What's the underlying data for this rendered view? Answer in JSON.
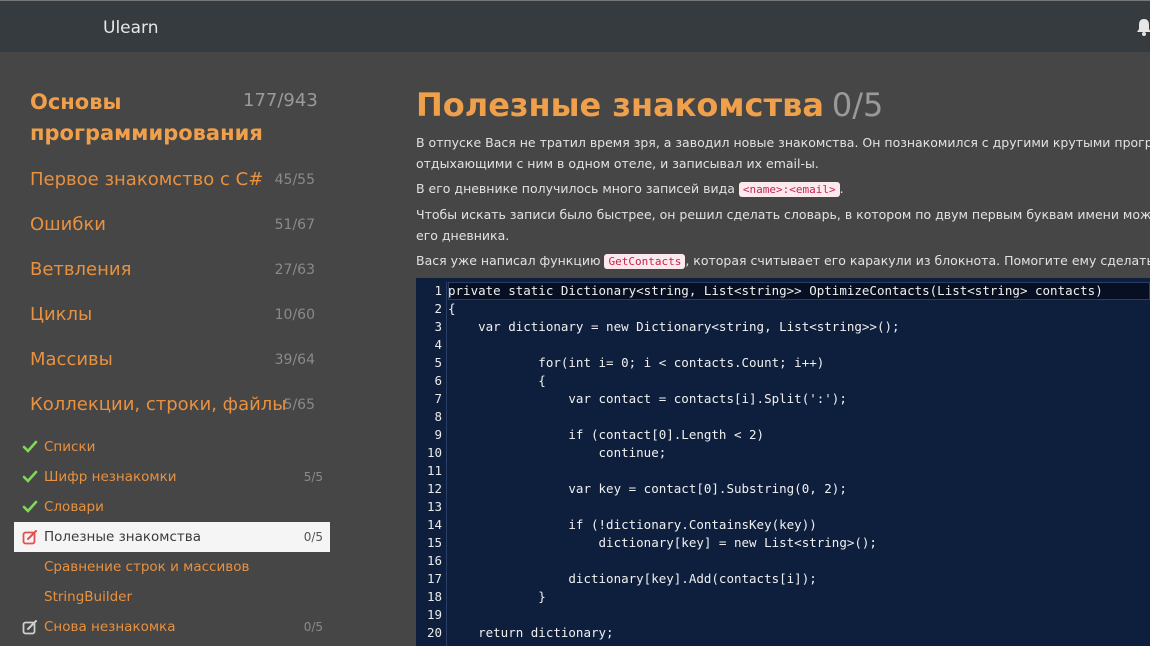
{
  "app": {
    "brand": "Ulearn"
  },
  "sidebar": {
    "course": {
      "title": "Основы программирования",
      "score": "177/943"
    },
    "units": [
      {
        "title": "Первое знакомство с C#",
        "score": "45/55"
      },
      {
        "title": "Ошибки",
        "score": "51/67"
      },
      {
        "title": "Ветвления",
        "score": "27/63"
      },
      {
        "title": "Циклы",
        "score": "10/60"
      },
      {
        "title": "Массивы",
        "score": "39/64"
      },
      {
        "title": "Коллекции, строки, файлы",
        "score": "5/65"
      }
    ],
    "slides": [
      {
        "title": "Списки",
        "score": "",
        "icon": "check-icon"
      },
      {
        "title": "Шифр незнакомки",
        "score": "5/5",
        "icon": "check-icon"
      },
      {
        "title": "Словари",
        "score": "",
        "icon": "check-icon"
      },
      {
        "title": "Полезные знакомства",
        "score": "0/5",
        "icon": "edit-icon",
        "active": true
      },
      {
        "title": "Сравнение строк и массивов",
        "score": "",
        "icon": ""
      },
      {
        "title": "StringBuilder",
        "score": "",
        "icon": ""
      },
      {
        "title": "Снова незнакомка",
        "score": "0/5",
        "icon": "edit-icon"
      }
    ]
  },
  "main": {
    "title": "Полезные знакомства",
    "score": "0/5",
    "p1_line1": "В отпуске Вася не тратил время зря, а заводил новые знакомства. Он познакомился с другими крутыми программистами,",
    "p1_line2": "отдыхающими с ним в одном отеле, и записывал их email-ы.",
    "p2_before": "В его дневнике получилось много записей вида ",
    "p2_code": "<name>:<email>",
    "p2_after": ".",
    "p3_line1": "Чтобы искать записи было быстрее, он решил сделать словарь, в котором по двум первым буквам имени можно найти все записи",
    "p3_line2": "его дневника.",
    "p4_before": "Вася уже написал функцию ",
    "p4_code": "GetContacts",
    "p4_after": ", которая считывает его каракули из блокнота. Помогите ему сделать всё остальное!"
  },
  "code": {
    "lines": [
      "private static Dictionary<string, List<string>> OptimizeContacts(List<string> contacts)",
      "{",
      "    var dictionary = new Dictionary<string, List<string>>();",
      "",
      "            for(int i= 0; i < contacts.Count; i++)",
      "            {",
      "                var contact = contacts[i].Split(':');",
      "",
      "                if (contact[0].Length < 2)",
      "                    continue;",
      "",
      "                var key = contact[0].Substring(0, 2);",
      "",
      "                if (!dictionary.ContainsKey(key))",
      "                    dictionary[key] = new List<string>();",
      "",
      "                dictionary[key].Add(contacts[i]);",
      "            }",
      "",
      "    return dictionary;"
    ],
    "line_numbers": [
      "1",
      "2",
      "3",
      "4",
      "5",
      "6",
      "7",
      "8",
      "9",
      "10",
      "11",
      "12",
      "13",
      "14",
      "15",
      "16",
      "17",
      "18",
      "19",
      "20"
    ]
  }
}
